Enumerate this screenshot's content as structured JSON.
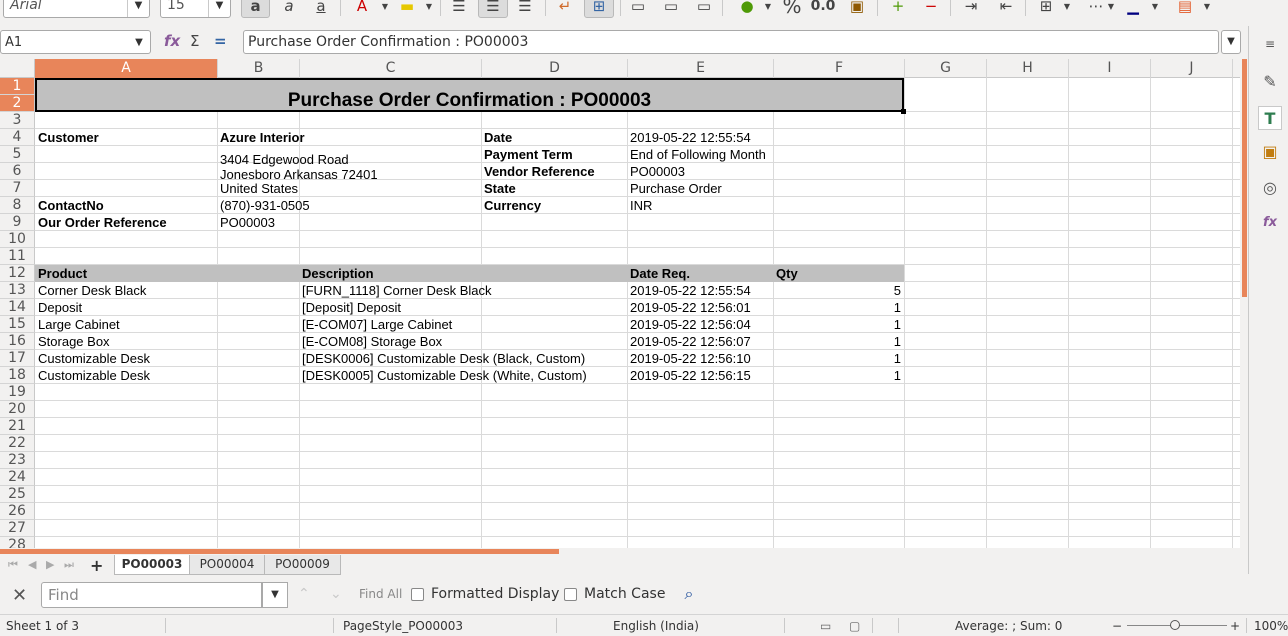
{
  "toolbar": {
    "font_name": "Arial",
    "font_size": "15",
    "percent_label": "%",
    "number_label": "0.0"
  },
  "formula_bar": {
    "cell_ref": "A1",
    "formula": "Purchase Order Confirmation : PO00003"
  },
  "columns": [
    "A",
    "B",
    "C",
    "D",
    "E",
    "F",
    "G",
    "H",
    "I",
    "J"
  ],
  "rows": [
    "1",
    "2",
    "3",
    "4",
    "5",
    "6",
    "7",
    "8",
    "9",
    "10",
    "11",
    "12",
    "13",
    "14",
    "15",
    "16",
    "17",
    "18",
    "19",
    "20",
    "21",
    "22",
    "23",
    "24",
    "25",
    "26",
    "27",
    "28"
  ],
  "sheet": {
    "title": "Purchase Order Confirmation : PO00003",
    "info_left": [
      {
        "label": "Customer",
        "value": "Azure Interior"
      },
      {
        "label": "",
        "value": "3404  Edgewood Road"
      },
      {
        "label": "",
        "value": "Jonesboro Arkansas 72401"
      },
      {
        "label": "",
        "value": "United States"
      },
      {
        "label": "ContactNo",
        "value": "(870)-931-0505"
      },
      {
        "label": "Our Order Reference",
        "value": "PO00003"
      }
    ],
    "info_right": [
      {
        "label": "Date",
        "value": "2019-05-22 12:55:54"
      },
      {
        "label": "Payment Term",
        "value": "End of Following Month"
      },
      {
        "label": "Vendor Reference",
        "value": "PO00003"
      },
      {
        "label": "State",
        "value": "Purchase Order"
      },
      {
        "label": "Currency",
        "value": "INR"
      }
    ],
    "table_headers": {
      "product": "Product",
      "description": "Description",
      "date": "Date Req.",
      "qty": "Qty"
    },
    "lines": [
      {
        "product": "Corner Desk Black",
        "description": "[FURN_1118] Corner Desk Black",
        "date": "2019-05-22 12:55:54",
        "qty": "5"
      },
      {
        "product": "Deposit",
        "description": "[Deposit] Deposit",
        "date": "2019-05-22 12:56:01",
        "qty": "1"
      },
      {
        "product": "Large Cabinet",
        "description": "[E-COM07] Large Cabinet",
        "date": "2019-05-22 12:56:04",
        "qty": "1"
      },
      {
        "product": "Storage Box",
        "description": "[E-COM08] Storage Box",
        "date": "2019-05-22 12:56:07",
        "qty": "1"
      },
      {
        "product": "Customizable Desk",
        "description": "[DESK0006] Customizable Desk (Black, Custom)",
        "date": "2019-05-22 12:56:10",
        "qty": "1"
      },
      {
        "product": "Customizable Desk",
        "description": "[DESK0005] Customizable Desk (White, Custom)",
        "date": "2019-05-22 12:56:15",
        "qty": "1"
      }
    ]
  },
  "tabs": [
    {
      "label": "PO00003",
      "active": true
    },
    {
      "label": "PO00004",
      "active": false
    },
    {
      "label": "PO00009",
      "active": false
    }
  ],
  "find": {
    "placeholder": "Find",
    "find_all": "Find All",
    "formatted_display": "Formatted Display",
    "match_case": "Match Case"
  },
  "status": {
    "sheet": "Sheet 1 of 3",
    "page_style": "PageStyle_PO00003",
    "language": "English (India)",
    "summary": "Average: ; Sum: 0",
    "zoom": "100%"
  },
  "colors": {
    "accent": "#e8855a",
    "header_fill": "#c0c0c0"
  }
}
